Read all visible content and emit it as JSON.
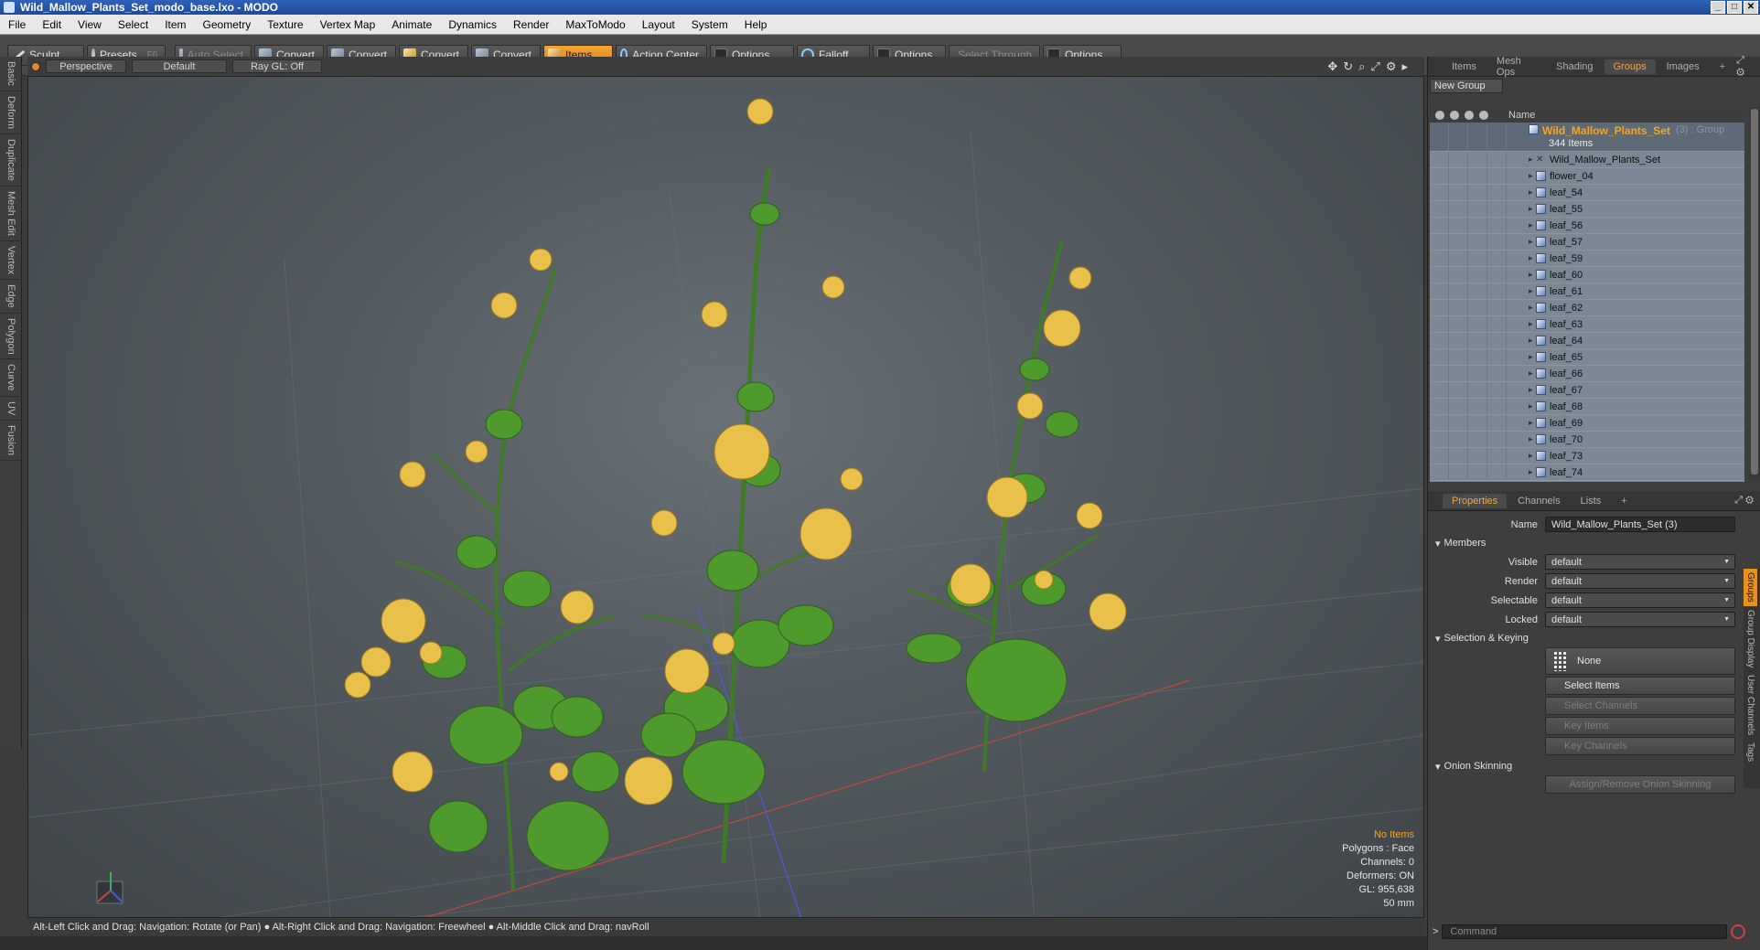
{
  "window": {
    "title": "Wild_Mallow_Plants_Set_modo_base.lxo - MODO"
  },
  "menu": [
    "File",
    "Edit",
    "View",
    "Select",
    "Item",
    "Geometry",
    "Texture",
    "Vertex Map",
    "Animate",
    "Dynamics",
    "Render",
    "MaxToModo",
    "Layout",
    "System",
    "Help"
  ],
  "toolbar": {
    "sculpt": "Sculpt",
    "presets": "Presets",
    "presets_hotkey": "F6",
    "auto_select": "Auto Select",
    "convert": "Convert",
    "items": "Items",
    "action_center": "Action Center",
    "options": "Options",
    "falloff": "Falloff",
    "select_through": "Select Through"
  },
  "left_tabs": [
    "Basic",
    "Deform",
    "Duplicate",
    "Mesh Edit",
    "Vertex",
    "Edge",
    "Polygon",
    "Curve",
    "UV",
    "Fusion"
  ],
  "viewport": {
    "view": "Perspective",
    "shading": "Default",
    "raygl": "Ray GL: Off",
    "info": {
      "selection": "No Items",
      "polygons": "Polygons : Face",
      "channels": "Channels: 0",
      "deformers": "Deformers: ON",
      "gl": "GL: 955,638",
      "scale": "50 mm"
    }
  },
  "status": {
    "hint": "Alt-Left Click and Drag: Navigation: Rotate (or Pan) ● Alt-Right Click and Drag: Navigation: Freewheel ● Alt-Middle Click and Drag: navRoll"
  },
  "right_tabs": [
    "Items",
    "Mesh Ops",
    "Shading",
    "Groups",
    "Images"
  ],
  "right_tabs_active": "Groups",
  "groups": {
    "new_group": "New Group",
    "col_name": "Name",
    "group_name": "Wild_Mallow_Plants_Set",
    "group_suffix": "(3) : Group",
    "group_count": "344 Items",
    "items": [
      "Wild_Mallow_Plants_Set",
      "flower_04",
      "leaf_54",
      "leaf_55",
      "leaf_56",
      "leaf_57",
      "leaf_59",
      "leaf_60",
      "leaf_61",
      "leaf_62",
      "leaf_63",
      "leaf_64",
      "leaf_65",
      "leaf_66",
      "leaf_67",
      "leaf_68",
      "leaf_69",
      "leaf_70",
      "leaf_73",
      "leaf_74"
    ]
  },
  "props_tabs": [
    "Properties",
    "Channels",
    "Lists"
  ],
  "properties": {
    "name_label": "Name",
    "name_value": "Wild_Mallow_Plants_Set (3)",
    "members": "Members",
    "visible_label": "Visible",
    "visible": "default",
    "render_label": "Render",
    "render": "default",
    "selectable_label": "Selectable",
    "selectable": "default",
    "locked_label": "Locked",
    "locked": "default",
    "sel_keying": "Selection & Keying",
    "none": "None",
    "select_items": "Select Items",
    "select_channels": "Select Channels",
    "key_items": "Key Items",
    "key_channels": "Key Channels",
    "onion": "Onion Skinning",
    "assign_onion": "Assign/Remove Onion Skinning"
  },
  "prop_vtabs": [
    "Groups",
    "Group Display",
    "User Channels",
    "Tags"
  ],
  "command": {
    "placeholder": "Command"
  }
}
